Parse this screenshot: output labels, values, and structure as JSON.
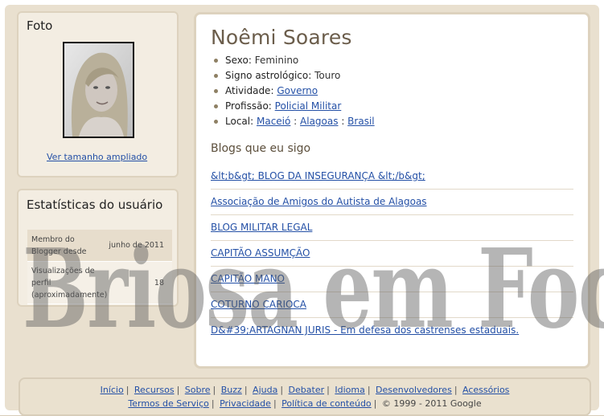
{
  "photo": {
    "title": "Foto",
    "enlarge_link": "Ver tamanho ampliado"
  },
  "stats": {
    "title": "Estatísticas do usuário",
    "rows": [
      {
        "label": "Membro do Blogger desde",
        "value": "junho de 2011"
      },
      {
        "label": "Visualizações de perfil (aproximadamente)",
        "value": "18"
      }
    ]
  },
  "profile": {
    "name": "Noêmi Soares",
    "info": [
      {
        "key": "Sexo:",
        "value": "Feminino"
      },
      {
        "key": "Signo astrológico:",
        "value": "Touro"
      },
      {
        "key": "Atividade:",
        "link": "Governo"
      },
      {
        "key": "Profissão:",
        "link": "Policial Militar"
      },
      {
        "key": "Local:",
        "links": [
          "Maceió",
          "Alagoas",
          "Brasil"
        ]
      }
    ]
  },
  "blogs": {
    "title": "Blogs que eu sigo",
    "items": [
      "&lt;b&gt; BLOG DA INSEGURANÇA &lt;/b&gt;",
      "Associação de Amigos do Autista de Alagoas",
      "BLOG MILITAR LEGAL",
      "CAPITÃO ASSUMÇÃO",
      "CAPITÃO MANO",
      "COTURNO CARIOCA",
      "D&#39;ARTAGNAN JURIS - Em defesa dos castrenses estaduais."
    ]
  },
  "watermark": "Briosa em Foco",
  "footer": {
    "row1": [
      "Início",
      "Recursos",
      "Sobre",
      "Buzz",
      "Ajuda",
      "Debater",
      "Idioma",
      "Desenvolvedores",
      "Acessórios"
    ],
    "row2": [
      "Termos de Serviço",
      "Privacidade",
      "Política de conteúdo"
    ],
    "copyright": "© 1999 - 2011 Google"
  },
  "colors": {
    "link": "#2450a6",
    "name": "#6b5d4b",
    "panel": "#f3ede2",
    "border": "#ddd2be"
  }
}
